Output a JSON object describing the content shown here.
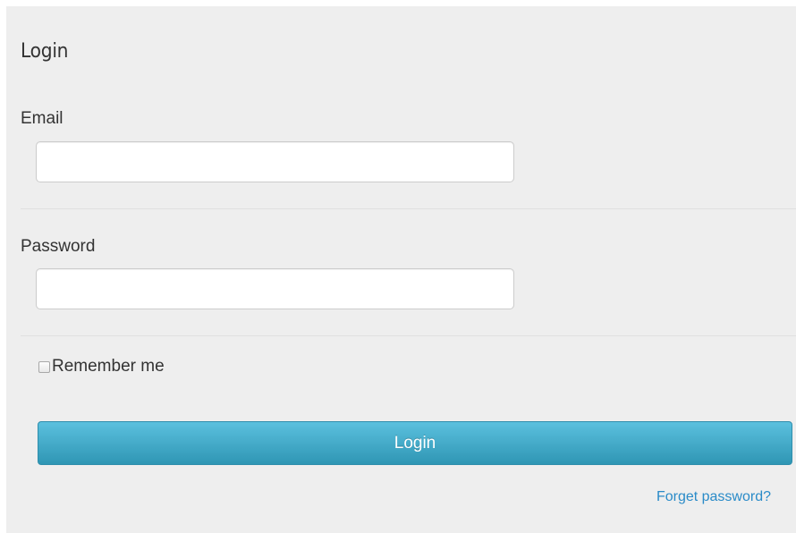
{
  "form": {
    "title": "Login",
    "email_label": "Email",
    "email_value": "",
    "password_label": "Password",
    "password_value": "",
    "remember_label": "Remember me",
    "remember_checked": false,
    "login_button": "Login",
    "forget_link": "Forget password?"
  },
  "colors": {
    "panel_background": "#eeeeee",
    "button_top": "#5bc0de",
    "button_bottom": "#2f96b4",
    "link": "#2a8bc8"
  }
}
